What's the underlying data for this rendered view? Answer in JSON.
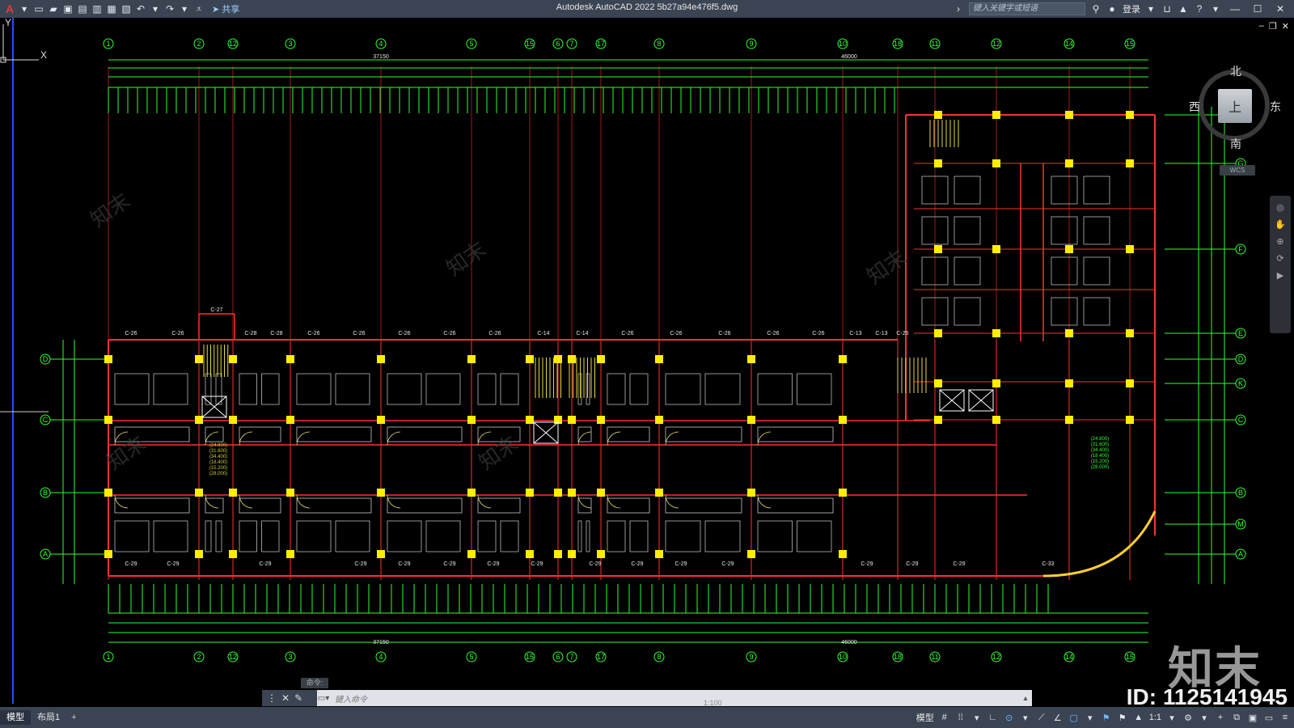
{
  "window": {
    "title": "Autodesk AutoCAD 2022    5b27a94e476f5.dwg",
    "app_logo": "A"
  },
  "toolbar": {
    "share_label": "共享",
    "search_placeholder": "键入关键字或短语",
    "login_label": "登录"
  },
  "viewcube": {
    "north": "北",
    "south": "南",
    "east": "东",
    "west": "西",
    "face": "上",
    "wcs": "WCS"
  },
  "drawing": {
    "axis_numbers_top": [
      "1",
      "2",
      "12",
      "3",
      "4",
      "5",
      "15",
      "6",
      "7",
      "17",
      "8",
      "9",
      "10",
      "18",
      "11",
      "12",
      "14",
      "15"
    ],
    "axis_letters_left": [
      "D",
      "C",
      "B",
      "A"
    ],
    "axis_letters_right": [
      "H",
      "G",
      "F",
      "E",
      "D",
      "K",
      "C",
      "B",
      "M",
      "A"
    ],
    "overall_dim_top": "37150",
    "overall_dim_right": "46000",
    "overall_dim_bottom": "37150",
    "overall_dim_bottom_right": "46000",
    "window_labels_top": [
      "C-26",
      "C-26",
      "C-28",
      "C-28",
      "C-26",
      "C-26",
      "C-26",
      "C-26",
      "C-26",
      "C-14",
      "C-14",
      "C-26",
      "C-26",
      "C-26",
      "C-26",
      "C-26",
      "C-13",
      "C-13",
      "C-25"
    ],
    "window_labels_bottom": [
      "C-29",
      "C-29",
      "C-29",
      "C-29",
      "C-29",
      "C-29",
      "C-29",
      "C-29",
      "C-29",
      "C-29",
      "C-29",
      "C-29",
      "C-29",
      "C-29",
      "C-29",
      "C-33"
    ],
    "stair_label": "C-27",
    "elevation_notes": [
      "(24.800)",
      "(31.600)",
      "(34.400)",
      "(18.400)",
      "(15.200)",
      "(28.000)"
    ]
  },
  "watermark": {
    "brand": "知末",
    "id_text": "ID: 1125141945"
  },
  "command": {
    "history_label": "命令:",
    "input_placeholder": "键入命令",
    "scale": "1:100"
  },
  "status": {
    "tabs": [
      "模型",
      "布局1"
    ],
    "model_label": "模型",
    "scale": "1:1"
  },
  "colors": {
    "background": "#000000",
    "wall": "#ff3030",
    "column": "#ffee00",
    "dimension": "#30ff30",
    "axis_bubble": "#30ff30",
    "titlebar": "#3b4453"
  }
}
